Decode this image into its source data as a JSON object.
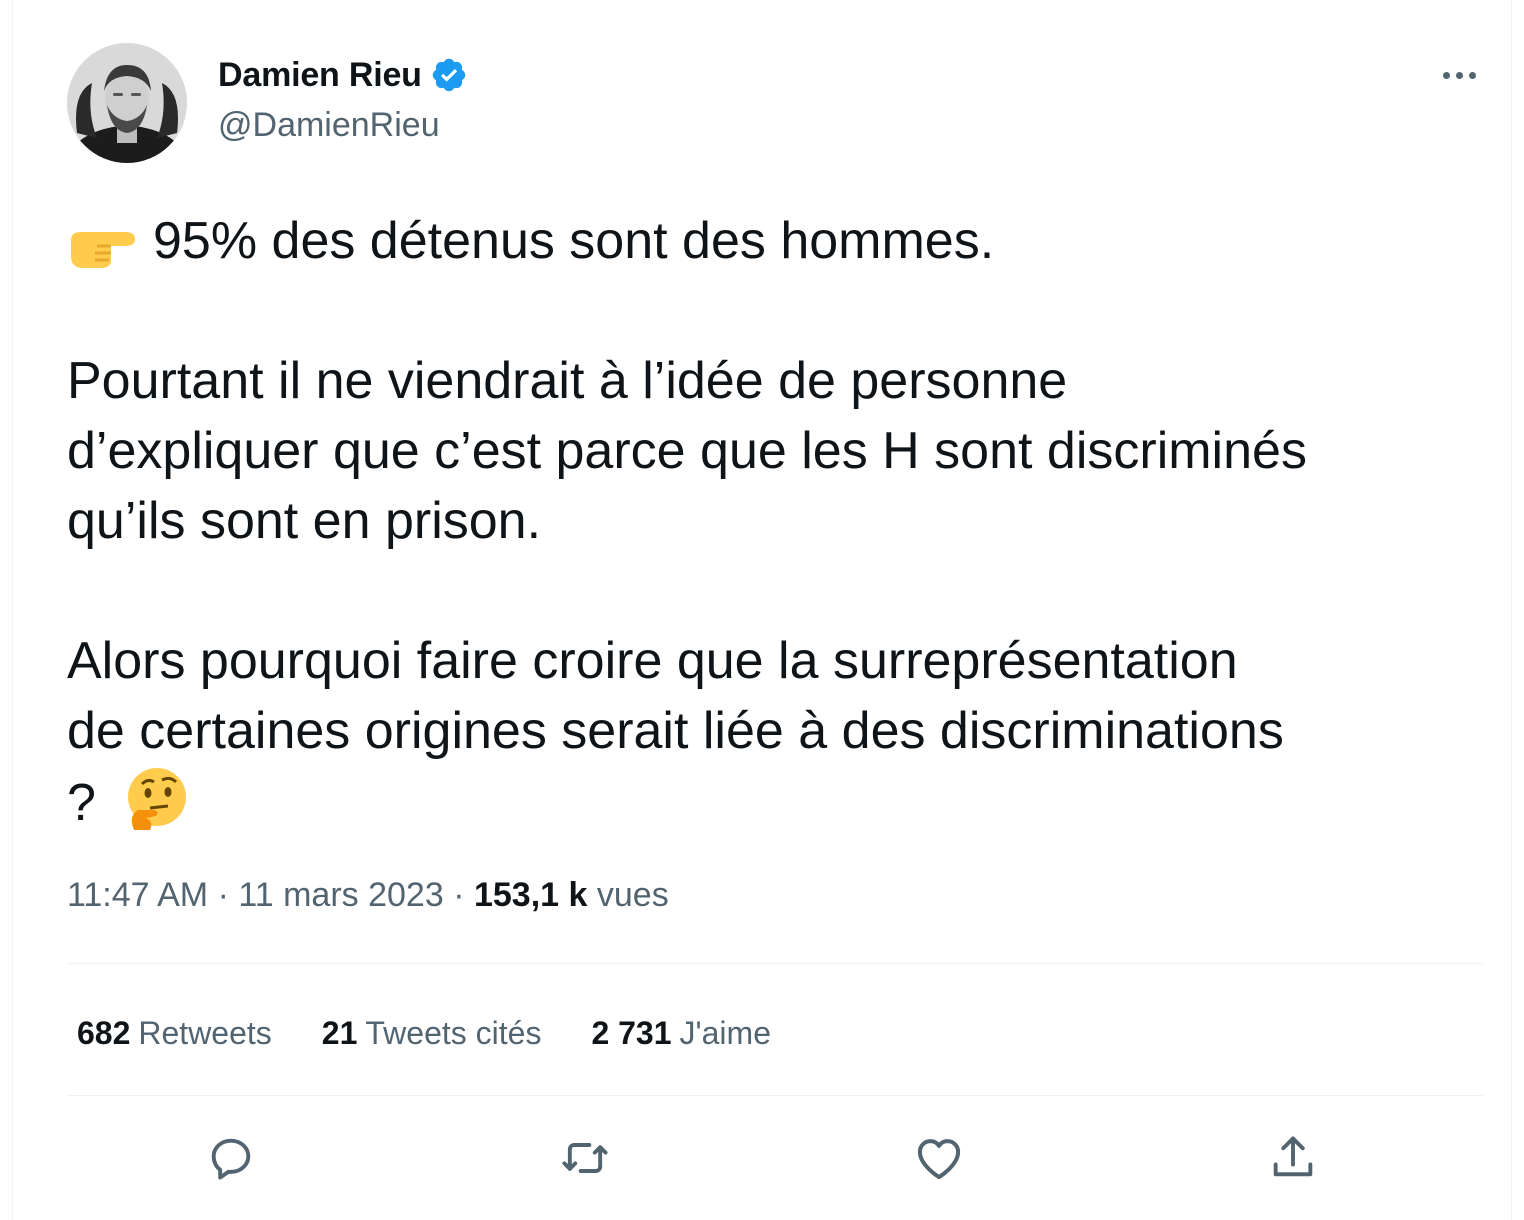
{
  "author": {
    "display_name": "Damien Rieu",
    "handle": "@DamienRieu",
    "verified_icon": "verified-badge-icon",
    "avatar_icon": "avatar-photo"
  },
  "more_icon": "more-options-icon",
  "tweet": {
    "line1": "95% des détenus sont des hommes.",
    "line1_emoji": "backhand-index-pointing-right",
    "paragraph2": [
      "Pourtant il ne viendrait à l’idée de personne",
      "d’expliquer que c’est parce que les H sont discriminés",
      "qu’ils sont en prison."
    ],
    "paragraph3": [
      "Alors pourquoi faire croire que la surreprésentation",
      "de certaines origines serait liée à des discriminations",
      "?"
    ],
    "end_emoji": "thinking-face"
  },
  "meta": {
    "time": "11:47 AM",
    "separator": " · ",
    "date": "11 mars 2023",
    "views_count": "153,1 k",
    "views_label": "vues"
  },
  "stats": {
    "retweets_count": "682",
    "retweets_label": "Retweets",
    "quotes_count": "21",
    "quotes_label": "Tweets cités",
    "likes_count": "2 731",
    "likes_label": "J'aime"
  },
  "actions": {
    "reply_icon": "reply-icon",
    "retweet_icon": "retweet-icon",
    "like_icon": "like-heart-icon",
    "share_icon": "share-icon"
  },
  "colors": {
    "text_primary": "#0f1419",
    "text_secondary": "#536471",
    "verified_blue": "#1d9bf0",
    "divider": "#eff3f4"
  }
}
